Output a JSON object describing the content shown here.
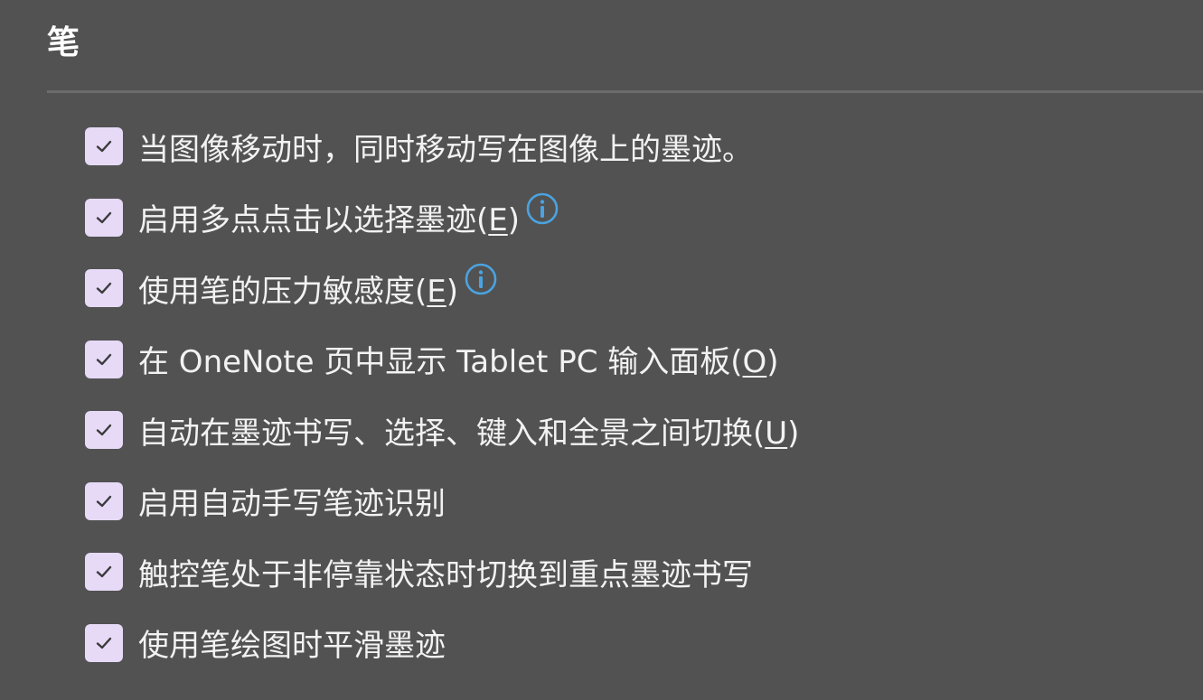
{
  "section": {
    "title": "笔"
  },
  "options": [
    {
      "text": "当图像移动时，同时移动写在图像上的墨迹。",
      "before": "",
      "hotkey": "",
      "after": "",
      "checked": true,
      "has_info": false
    },
    {
      "text": "启用多点点击以选择墨迹(",
      "hotkey": "E",
      "after": ")",
      "checked": true,
      "has_info": true
    },
    {
      "text": "使用笔的压力敏感度(",
      "hotkey": "E",
      "after": ")",
      "checked": true,
      "has_info": true
    },
    {
      "text": "在 OneNote 页中显示 Tablet PC 输入面板(",
      "hotkey": "O",
      "after": ")",
      "checked": true,
      "has_info": false
    },
    {
      "text": "自动在墨迹书写、选择、键入和全景之间切换(",
      "hotkey": "U",
      "after": ")",
      "checked": true,
      "has_info": false
    },
    {
      "text": "启用自动手写笔迹识别",
      "hotkey": "",
      "after": "",
      "checked": true,
      "has_info": false
    },
    {
      "text": "触控笔处于非停靠状态时切换到重点墨迹书写",
      "hotkey": "",
      "after": "",
      "checked": true,
      "has_info": false
    },
    {
      "text": "使用笔绘图时平滑墨迹",
      "hotkey": "",
      "after": "",
      "checked": true,
      "has_info": false
    }
  ],
  "icons": {
    "checkbox": "checkmark-icon",
    "info": "info-icon"
  },
  "colors": {
    "background": "#525252",
    "checkbox_fill": "#e6daf7",
    "checkmark": "#3a3a3a",
    "info_accent": "#4aa3e0",
    "text": "#f2f2f2"
  }
}
